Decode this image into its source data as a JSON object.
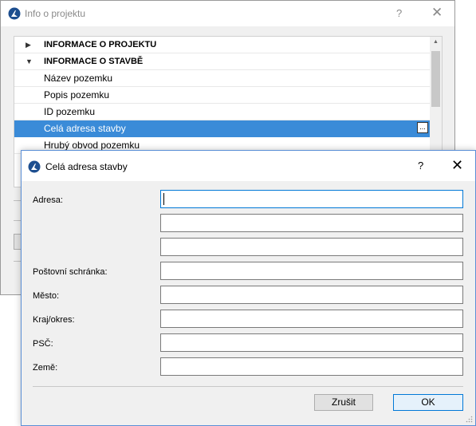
{
  "back_window": {
    "title": "Info o projektu",
    "help": "?",
    "close": "✕",
    "tree": {
      "rows": [
        {
          "label": "INFORMACE O PROJEKTU",
          "header": true,
          "expanded": false
        },
        {
          "label": "INFORMACE O STAVBĚ",
          "header": true,
          "expanded": true
        },
        {
          "label": "Název pozemku"
        },
        {
          "label": "Popis pozemku"
        },
        {
          "label": "ID pozemku"
        },
        {
          "label": "Celá adresa stavby",
          "selected": true,
          "button": "..."
        },
        {
          "label": "Hrubý obvod pozemku"
        }
      ]
    }
  },
  "dialog": {
    "title": "Celá adresa stavby",
    "help": "?",
    "close": "✕",
    "fields": {
      "adresa_label": "Adresa:",
      "posta_label": "Poštovní schránka:",
      "mesto_label": "Město:",
      "kraj_label": "Kraj/okres:",
      "psc_label": "PSČ:",
      "zeme_label": "Země:"
    },
    "values": {
      "adresa1": "",
      "adresa2": "",
      "adresa3": "",
      "posta": "",
      "mesto": "",
      "kraj": "",
      "psc": "",
      "zeme": ""
    },
    "buttons": {
      "cancel": "Zrušit",
      "ok": "OK"
    }
  },
  "colors": {
    "selection": "#3a8bd8",
    "focus_border": "#0078d7",
    "app_logo": "#1d4e8f"
  }
}
